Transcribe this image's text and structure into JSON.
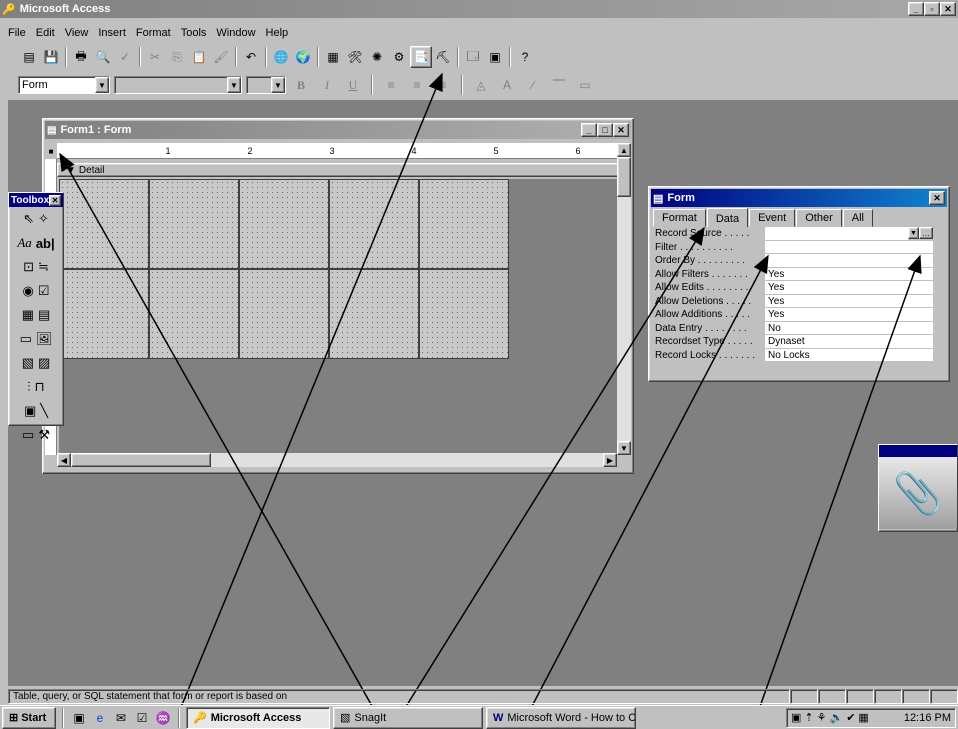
{
  "app": {
    "title": "Microsoft Access"
  },
  "menu": [
    "File",
    "Edit",
    "View",
    "Insert",
    "Format",
    "Tools",
    "Window",
    "Help"
  ],
  "format_bar": {
    "object_combo": "Form",
    "font_combo": "",
    "size_combo": ""
  },
  "form_window": {
    "title": "Form1 : Form",
    "section": "Detail",
    "ruler_numbers": [
      "1",
      "2",
      "3",
      "4",
      "5",
      "6"
    ]
  },
  "toolbox": {
    "title": "Toolbox"
  },
  "property_sheet": {
    "title": "Form",
    "tabs": [
      "Format",
      "Data",
      "Event",
      "Other",
      "All"
    ],
    "active_tab": "Data",
    "rows": [
      {
        "label": "Record Source . . . . .",
        "value": ""
      },
      {
        "label": "Filter . . . . . . . . . .",
        "value": ""
      },
      {
        "label": "Order By . . . . . . . . .",
        "value": ""
      },
      {
        "label": "Allow Filters . . . . . . .",
        "value": "Yes"
      },
      {
        "label": "Allow Edits . . . . . . . .",
        "value": "Yes"
      },
      {
        "label": "Allow Deletions . . . . .",
        "value": "Yes"
      },
      {
        "label": "Allow Additions . . . . .",
        "value": "Yes"
      },
      {
        "label": "Data Entry . . . . . . . .",
        "value": "No"
      },
      {
        "label": "Recordset Type . . . . .",
        "value": "Dynaset"
      },
      {
        "label": "Record Locks . . . . . . .",
        "value": "No Locks"
      }
    ]
  },
  "status_bar": {
    "text": "Table, query, or SQL statement that form or report is based on"
  },
  "taskbar": {
    "start": "Start",
    "tasks": [
      "Microsoft Access",
      "SnagIt",
      "Microsoft Word - How to C..."
    ],
    "clock": "12:16 PM"
  },
  "colors": {
    "title_active": "#000080",
    "title_inactive": "#808080",
    "desktop": "#808080"
  }
}
